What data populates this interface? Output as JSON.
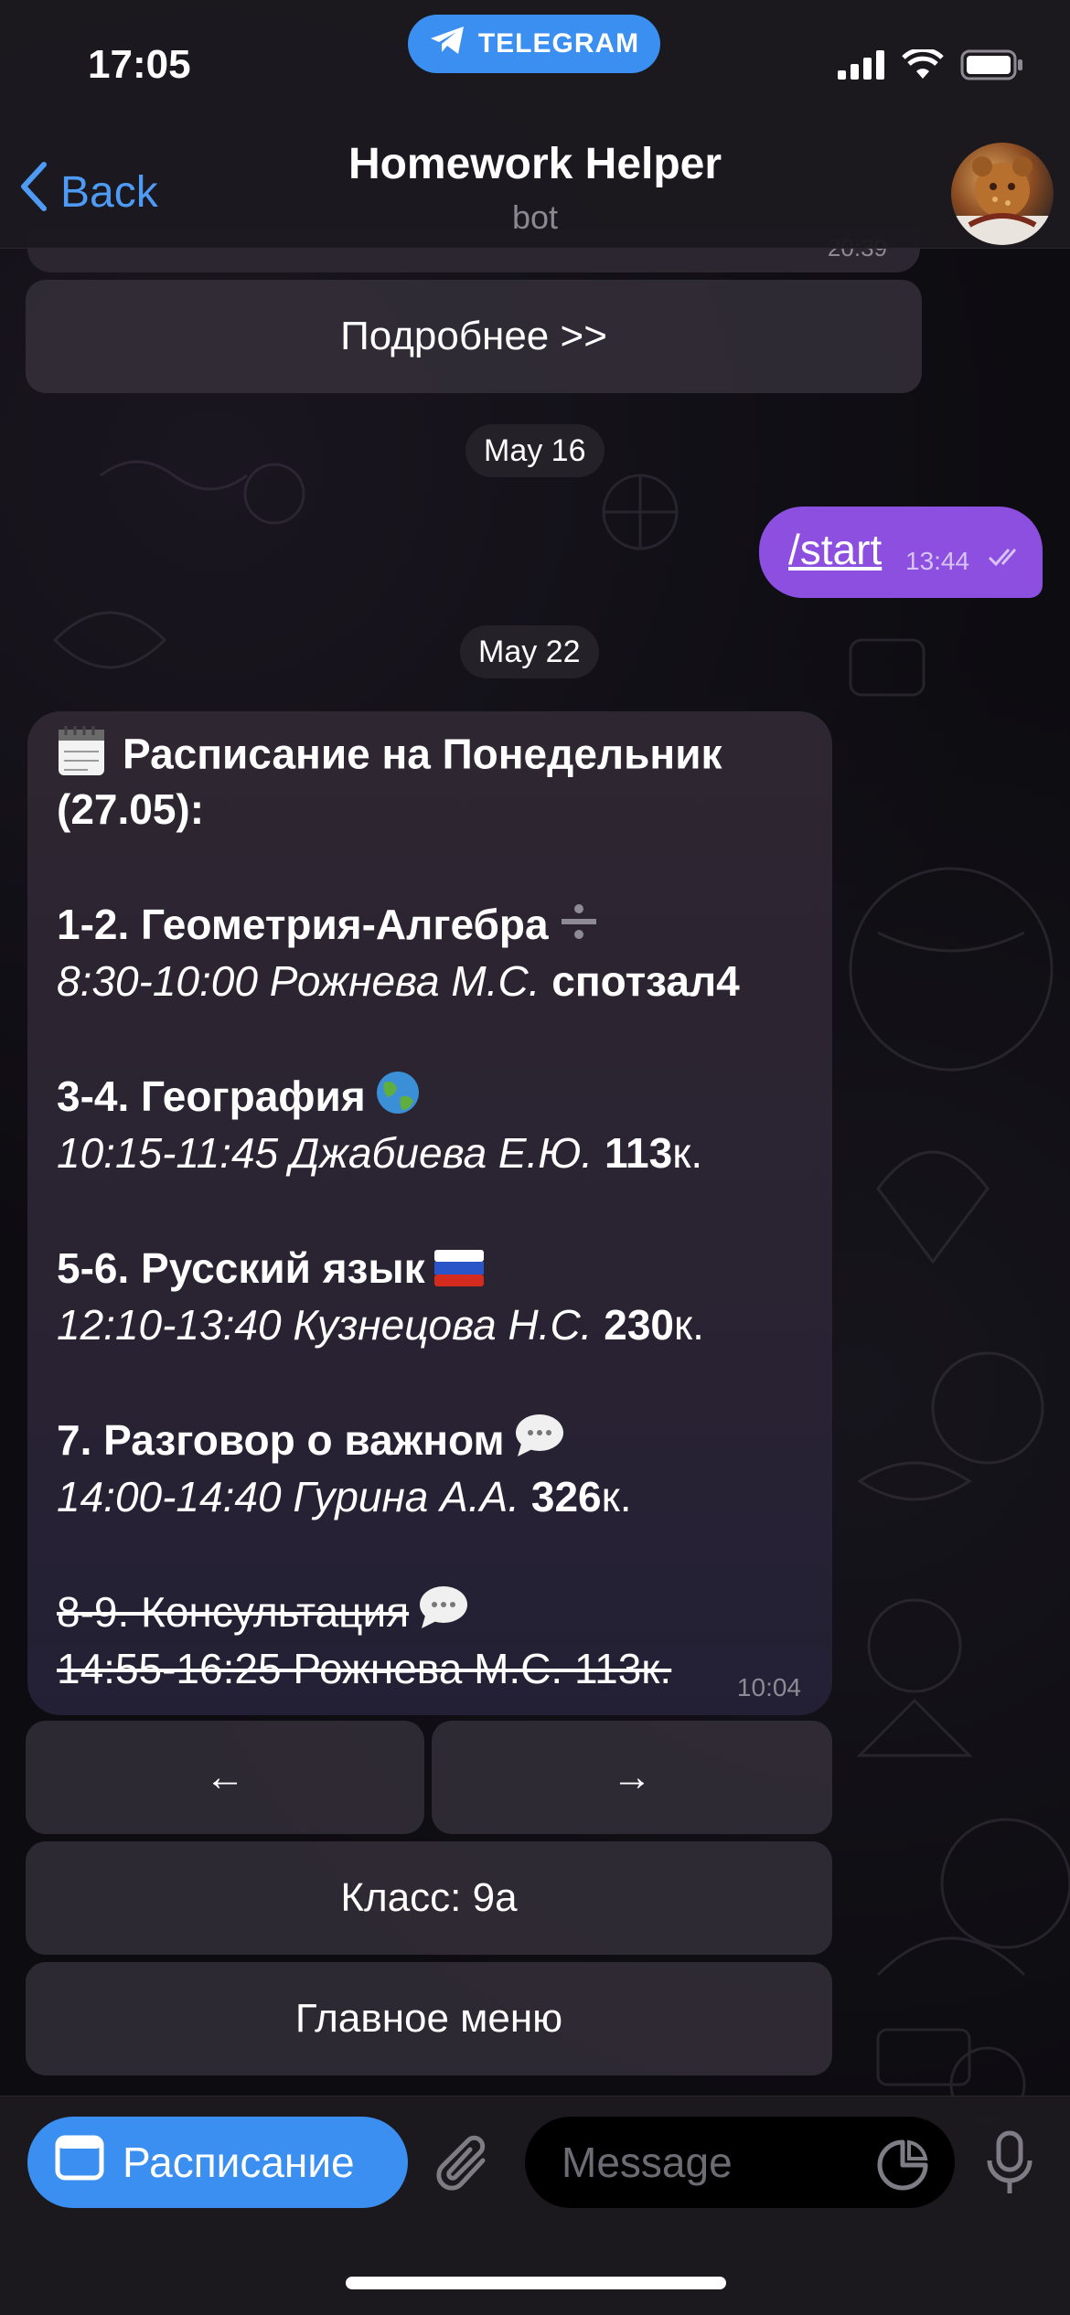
{
  "status_bar": {
    "time": "17:05",
    "pill_label": "TELEGRAM",
    "icons": [
      "signal-icon",
      "wifi-icon",
      "battery-icon"
    ]
  },
  "header": {
    "back_label": "Back",
    "title": "Homework Helper",
    "subtitle": "bot"
  },
  "chat": {
    "partial_time": "20:39",
    "details_button": "Подробнее >>",
    "date_1": "May 16",
    "outgoing": {
      "text": "/start",
      "time": "13:44"
    },
    "date_2": "May 22",
    "schedule": {
      "title_line1": "Расписание на Понедельник",
      "title_line2": "(27.05):",
      "lessons": [
        {
          "name": "1-2. Геометрия-Алгебра",
          "time_teacher": "8:30-10:00 Рожнева М.С.",
          "room": "спотзал4",
          "room_suffix": "",
          "emoji": "➗"
        },
        {
          "name": "3-4. География",
          "time_teacher": "10:15-11:45 Джабиева Е.Ю.",
          "room": "113",
          "room_suffix": "к.",
          "emoji": "🌍"
        },
        {
          "name": "5-6. Русский язык",
          "time_teacher": "12:10-13:40 Кузнецова Н.С.",
          "room": "230",
          "room_suffix": "к.",
          "emoji": "🇷🇺"
        },
        {
          "name": "7. Разговор о важном",
          "time_teacher": "14:00-14:40 Гурина А.А.",
          "room": "326",
          "room_suffix": "к.",
          "emoji": "💬"
        }
      ],
      "cancelled": {
        "name": "8-9. Консультация",
        "details": "14:55-16:25 Рожнева М.С. 113к.",
        "emoji": "💬"
      },
      "time": "10:04"
    },
    "keyboard": {
      "prev": "←",
      "next": "→",
      "class_button": "Класс: 9а",
      "main_menu": "Главное меню"
    }
  },
  "input_bar": {
    "menu_button": "Расписание",
    "placeholder": "Message"
  },
  "colors": {
    "accent": "#3a8ff0",
    "outgoing_bubble": "#8c4fe0",
    "incoming_bubble": "#2a2332"
  }
}
